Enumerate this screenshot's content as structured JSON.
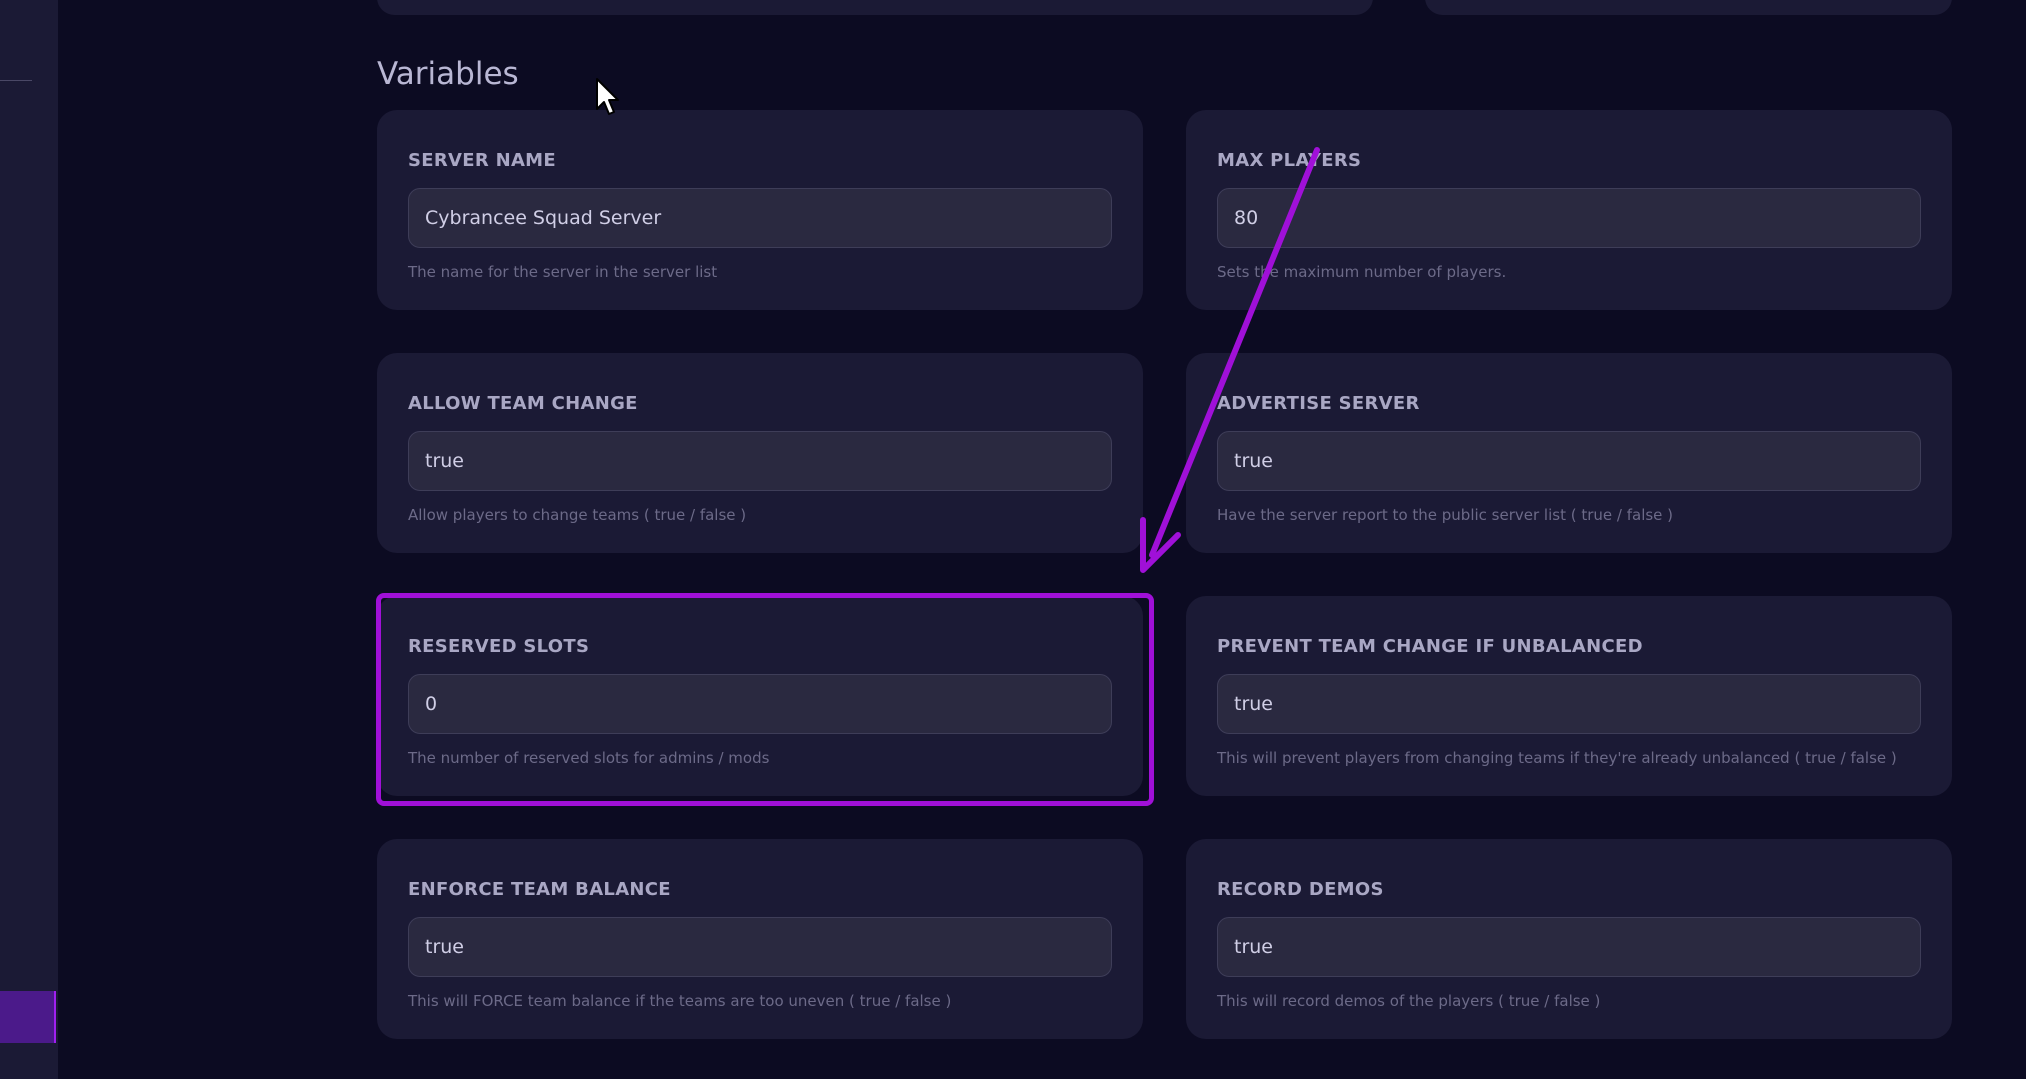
{
  "section": {
    "title": "Variables"
  },
  "variables": [
    {
      "label": "SERVER NAME",
      "value": "Cybrancee Squad Server",
      "description": "The name for the server in the server list"
    },
    {
      "label": "MAX PLAYERS",
      "value": "80",
      "description": "Sets the maximum number of players."
    },
    {
      "label": "ALLOW TEAM CHANGE",
      "value": "true",
      "description": "Allow players to change teams ( true / false )"
    },
    {
      "label": "ADVERTISE SERVER",
      "value": "true",
      "description": "Have the server report to the public server list ( true / false )"
    },
    {
      "label": "RESERVED SLOTS",
      "value": "0",
      "description": "The number of reserved slots for admins / mods"
    },
    {
      "label": "PREVENT TEAM CHANGE IF UNBALANCED",
      "value": "true",
      "description": "This will prevent players from changing teams if they're already unbalanced ( true / false )"
    },
    {
      "label": "ENFORCE TEAM BALANCE",
      "value": "true",
      "description": "This will FORCE team balance if the teams are too uneven ( true / false )"
    },
    {
      "label": "RECORD DEMOS",
      "value": "true",
      "description": "This will record demos of the players ( true / false )"
    }
  ],
  "colors": {
    "background": "#0c0b22",
    "card": "#1b1a35",
    "input": "#2a2940",
    "accent": "#a010d8",
    "sidebar_active": "#4b1a8a"
  },
  "icons": {
    "cursor": "mouse-pointer-icon",
    "annotation": "annotation-arrow"
  }
}
